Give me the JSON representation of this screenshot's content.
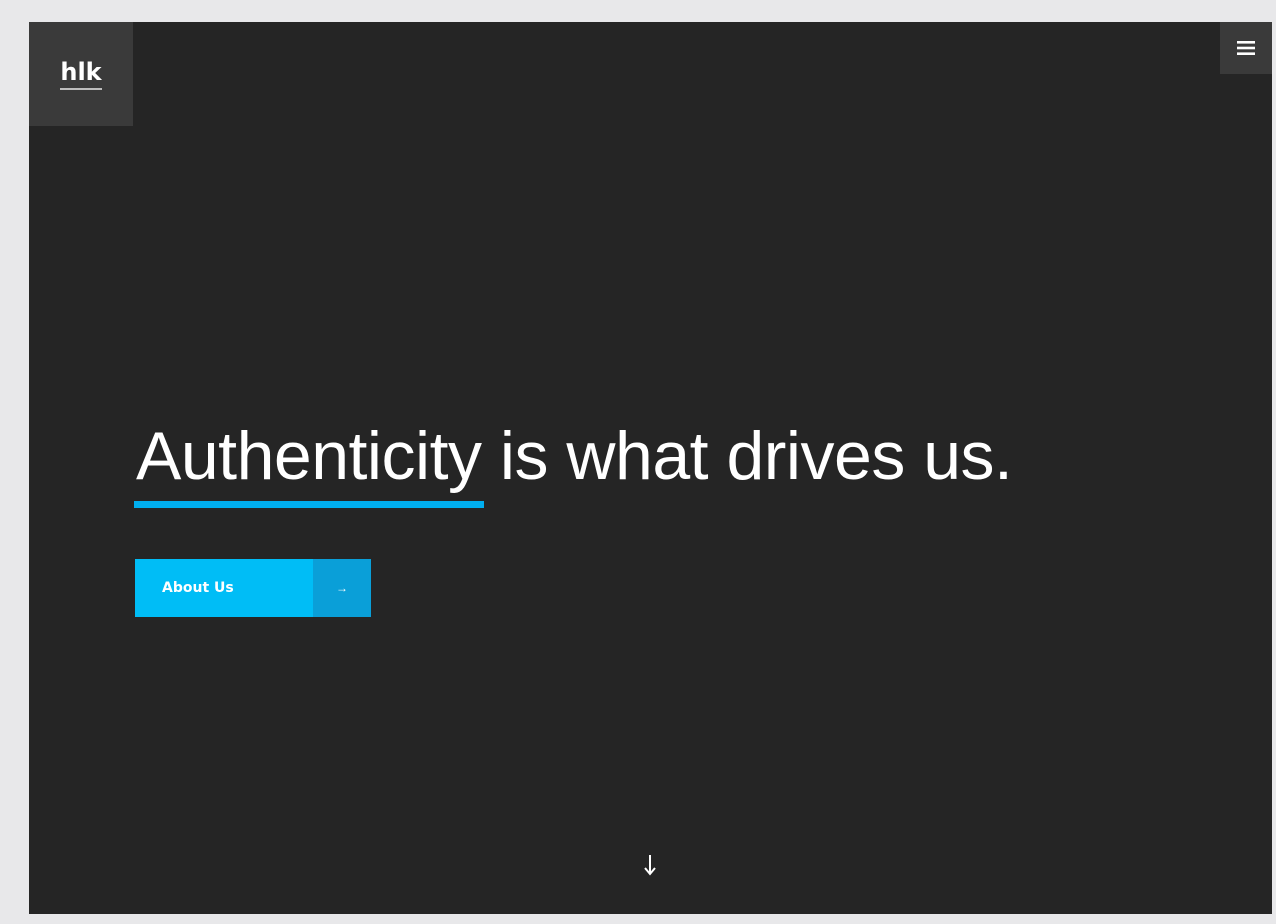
{
  "header": {
    "logo_text": "hlk",
    "menu_icon": "hamburger-menu-icon"
  },
  "hero": {
    "headline_accent": "Authenticity",
    "headline_rest": " is what drives us.",
    "accent_color": "#00aeef"
  },
  "cta": {
    "label": "About Us",
    "arrow": "→",
    "color": "#00bdf6",
    "arrow_bg": "#0a9fd8"
  },
  "footer": {
    "scroll_icon": "arrow-down-icon"
  },
  "colors": {
    "background": "#252525",
    "tile": "#3a3a3a",
    "text": "#ffffff"
  }
}
